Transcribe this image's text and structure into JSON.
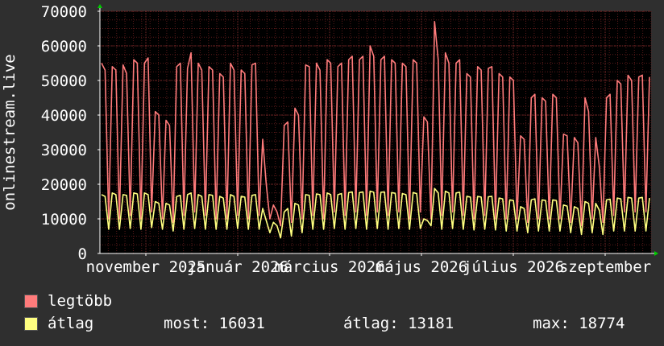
{
  "chart_data": {
    "type": "line",
    "ylabel": "onlinestream.live",
    "ylim": [
      0,
      70000
    ],
    "yticks": [
      0,
      10000,
      20000,
      30000,
      40000,
      50000,
      60000,
      70000
    ],
    "xticks": [
      "november 2025",
      "január 2026",
      "március 2026",
      "május 2026",
      "július 2026",
      "szeptember"
    ],
    "grid": true,
    "background": "#000000",
    "grid_color": "#5a1a1a",
    "axis_color": "#ffffff",
    "series": [
      {
        "name": "legtöbb",
        "color": "#ff7b7b",
        "values": [
          55000,
          53000,
          10000,
          54000,
          53000,
          10000,
          54500,
          52000,
          11000,
          56000,
          55000,
          10000,
          55000,
          56500,
          12000,
          41000,
          40000,
          10000,
          38500,
          37000,
          9000,
          54000,
          55000,
          11000,
          53500,
          58000,
          12000,
          55000,
          53000,
          11000,
          54000,
          53000,
          10000,
          52000,
          51000,
          10000,
          55000,
          53000,
          11000,
          53000,
          52000,
          10000,
          54500,
          55000,
          11000,
          33000,
          20000,
          10000,
          14000,
          12000,
          8000,
          37000,
          38000,
          9000,
          42000,
          40000,
          10000,
          54500,
          54000,
          11000,
          55000,
          53000,
          10000,
          56000,
          55000,
          12000,
          54000,
          55000,
          11000,
          56000,
          57000,
          12000,
          56000,
          57000,
          11000,
          60000,
          57000,
          12000,
          56000,
          57000,
          11000,
          56000,
          55000,
          12000,
          55000,
          54000,
          10000,
          56000,
          55000,
          12000,
          39500,
          38000,
          10000,
          67000,
          56000,
          11000,
          58000,
          55000,
          12000,
          55000,
          56000,
          11000,
          52000,
          51000,
          10000,
          54000,
          53000,
          11000,
          53500,
          54000,
          10000,
          52000,
          51000,
          10000,
          51000,
          50000,
          10000,
          34000,
          33000,
          9000,
          45000,
          46000,
          10000,
          45000,
          44000,
          10000,
          46000,
          45000,
          10000,
          34500,
          34000,
          9000,
          33500,
          32000,
          8000,
          45000,
          41000,
          10000,
          33500,
          25000,
          9000,
          45000,
          46000,
          11000,
          50000,
          49000,
          12000,
          51500,
          50000,
          12000,
          51000,
          51500,
          12000,
          51000
        ]
      },
      {
        "name": "átlag",
        "color": "#ffff80",
        "values": [
          17000,
          16500,
          7000,
          17500,
          17000,
          7000,
          17000,
          16800,
          7200,
          17500,
          17200,
          7000,
          17500,
          17000,
          7500,
          15000,
          14500,
          7000,
          14500,
          14000,
          6500,
          16500,
          16800,
          7000,
          17000,
          17500,
          7200,
          17000,
          16500,
          7000,
          17000,
          16800,
          7000,
          16500,
          16000,
          7000,
          17000,
          16500,
          7200,
          16500,
          16300,
          7000,
          16800,
          17000,
          7000,
          13000,
          9500,
          6000,
          9000,
          8000,
          4500,
          12000,
          13000,
          5000,
          14500,
          14000,
          6000,
          17000,
          16800,
          7000,
          17200,
          17000,
          7000,
          17500,
          17000,
          7200,
          17000,
          17300,
          7000,
          17600,
          17800,
          7200,
          17600,
          17800,
          7000,
          18000,
          17700,
          7200,
          17700,
          17800,
          7000,
          17600,
          17400,
          7200,
          17300,
          17000,
          7000,
          17600,
          17300,
          7200,
          10000,
          9500,
          8000,
          18774,
          17500,
          7000,
          18000,
          17500,
          7200,
          17500,
          17700,
          7000,
          16500,
          16300,
          6800,
          16500,
          16300,
          7000,
          16400,
          16500,
          6800,
          16000,
          15800,
          6500,
          15500,
          15300,
          6500,
          13500,
          13000,
          6000,
          15500,
          15800,
          6500,
          15500,
          15300,
          6500,
          15500,
          15300,
          6500,
          14000,
          13700,
          6000,
          13500,
          13000,
          5500,
          15000,
          14500,
          6000,
          14500,
          12500,
          5500,
          15500,
          15700,
          6500,
          16000,
          15800,
          6500,
          16200,
          16000,
          6500,
          16000,
          16200,
          6500,
          16031
        ]
      }
    ]
  },
  "legend": {
    "max_label": "legtöbb",
    "avg_label": "átlag",
    "most_text": "most: 16031",
    "avg_text": "átlag: 13181",
    "max_text": "max: 18774"
  }
}
